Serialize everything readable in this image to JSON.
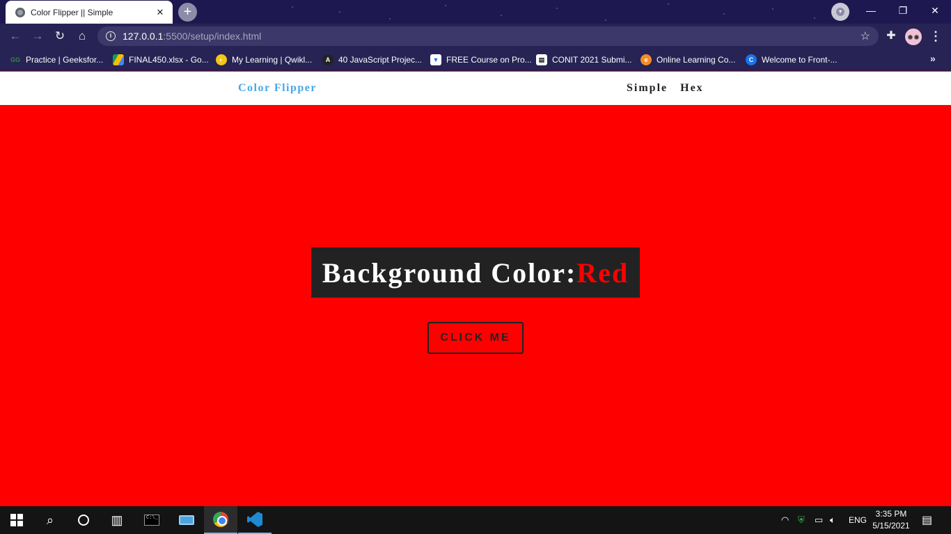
{
  "browser": {
    "tab": {
      "title": "Color Flipper || Simple",
      "close_glyph": "✕",
      "favicon": "globe-icon"
    },
    "new_tab_glyph": "+",
    "window_controls": {
      "minimize": "—",
      "restore": "❐",
      "close": "✕"
    },
    "address": {
      "host": "127.0.0.1",
      "path": ":5500/setup/index.html"
    },
    "bookmarks": [
      {
        "label": "Practice | Geeksfor...",
        "icon": "geeksforgeeks-icon",
        "color": "#2f8d46"
      },
      {
        "label": "FINAL450.xlsx - Go...",
        "icon": "google-drive-icon",
        "color": "#fbbc05"
      },
      {
        "label": "My Learning | Qwikl...",
        "icon": "qwiklabs-icon",
        "color": "#f5c518"
      },
      {
        "label": "40 JavaScript Projec...",
        "icon": "react-icon",
        "color": "#222222"
      },
      {
        "label": "FREE Course on Pro...",
        "icon": "course-icon",
        "color": "#1a73e8"
      },
      {
        "label": "CONIT 2021 Submi...",
        "icon": "document-icon",
        "color": "#ffffff"
      },
      {
        "label": "Online Learning Co...",
        "icon": "edureka-icon",
        "color": "#f28c28"
      },
      {
        "label": "Welcome to Front-...",
        "icon": "c-icon",
        "color": "#1a73e8"
      }
    ],
    "more_bookmarks_glyph": "»"
  },
  "page": {
    "navbar": {
      "brand": "Color Flipper",
      "links": [
        "Simple",
        "Hex"
      ]
    },
    "color_box": {
      "label": "Background Color:",
      "value": "Red"
    },
    "button_label": "CLICK ME",
    "background_color": "#ff0000",
    "brand_color": "#49a6e9"
  },
  "taskbar": {
    "language": "ENG",
    "time": "3:35 PM",
    "date": "5/15/2021"
  }
}
